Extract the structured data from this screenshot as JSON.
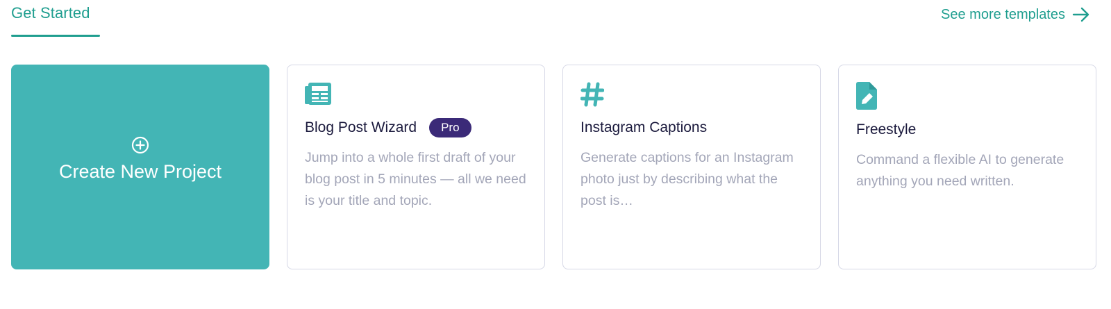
{
  "header": {
    "tab_label": "Get Started",
    "see_more_label": "See more templates"
  },
  "icons": {
    "see_more": "arrow-right-icon",
    "create": "plus-circle-icon",
    "blog": "newspaper-icon",
    "instagram": "hashtag-icon",
    "freestyle": "file-pen-icon"
  },
  "colors": {
    "accent": "#1f9e8f",
    "primary_card": "#43b5b5",
    "pro_badge": "#3b2a78",
    "title_text": "#1b1a3d",
    "desc_text": "#a3a6b8",
    "card_border": "#d6d8e6"
  },
  "create_card": {
    "label": "Create New Project"
  },
  "templates": [
    {
      "title": "Blog Post Wizard",
      "badge": "Pro",
      "description": "Jump into a whole first draft of your blog post in 5 minutes — all we need is your title and topic."
    },
    {
      "title": "Instagram Captions",
      "description": "Generate captions for an Instagram photo just by describing what the post is…"
    },
    {
      "title": "Freestyle",
      "description": "Command a flexible AI to generate anything you need written."
    }
  ]
}
